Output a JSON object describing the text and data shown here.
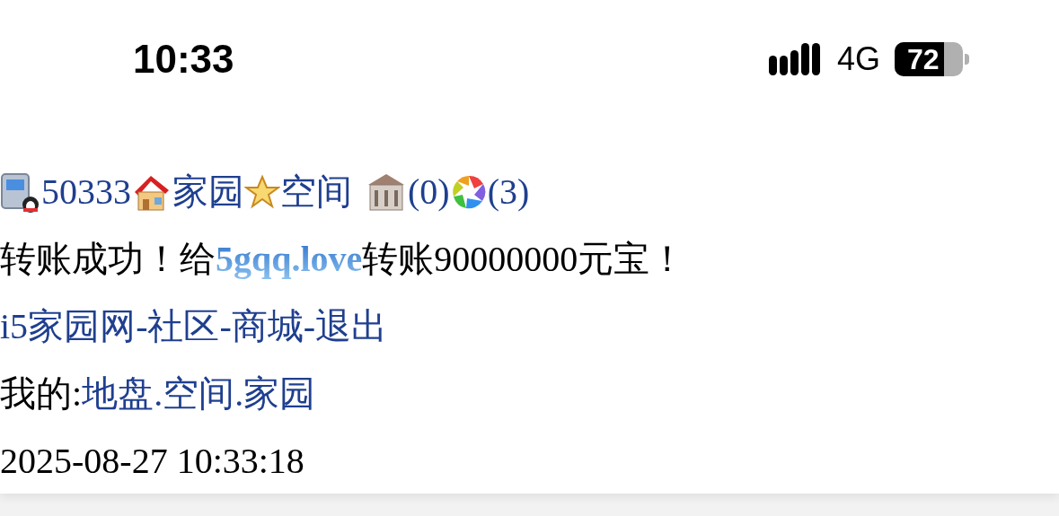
{
  "status_bar": {
    "time": "10:33",
    "network": "4G",
    "battery": "72"
  },
  "header_links": [
    {
      "kind": "qq",
      "text": "50333"
    },
    {
      "kind": "home",
      "text": "家园"
    },
    {
      "kind": "star",
      "text": "空间"
    },
    {
      "kind": "bank",
      "text": "(0)"
    },
    {
      "kind": "album",
      "text": "(3)"
    }
  ],
  "message": {
    "before": "转账成功！给",
    "recipient": "5gqq.love",
    "after": "转账90000000元宝！"
  },
  "nav": {
    "separator": "-",
    "links": [
      "i5家园网",
      "社区",
      "商城",
      "退出"
    ]
  },
  "mine": {
    "label": "我的:",
    "separator": ".",
    "links": [
      "地盘",
      "空间",
      "家园"
    ]
  },
  "timestamp": "2025-08-27 10:33:18"
}
